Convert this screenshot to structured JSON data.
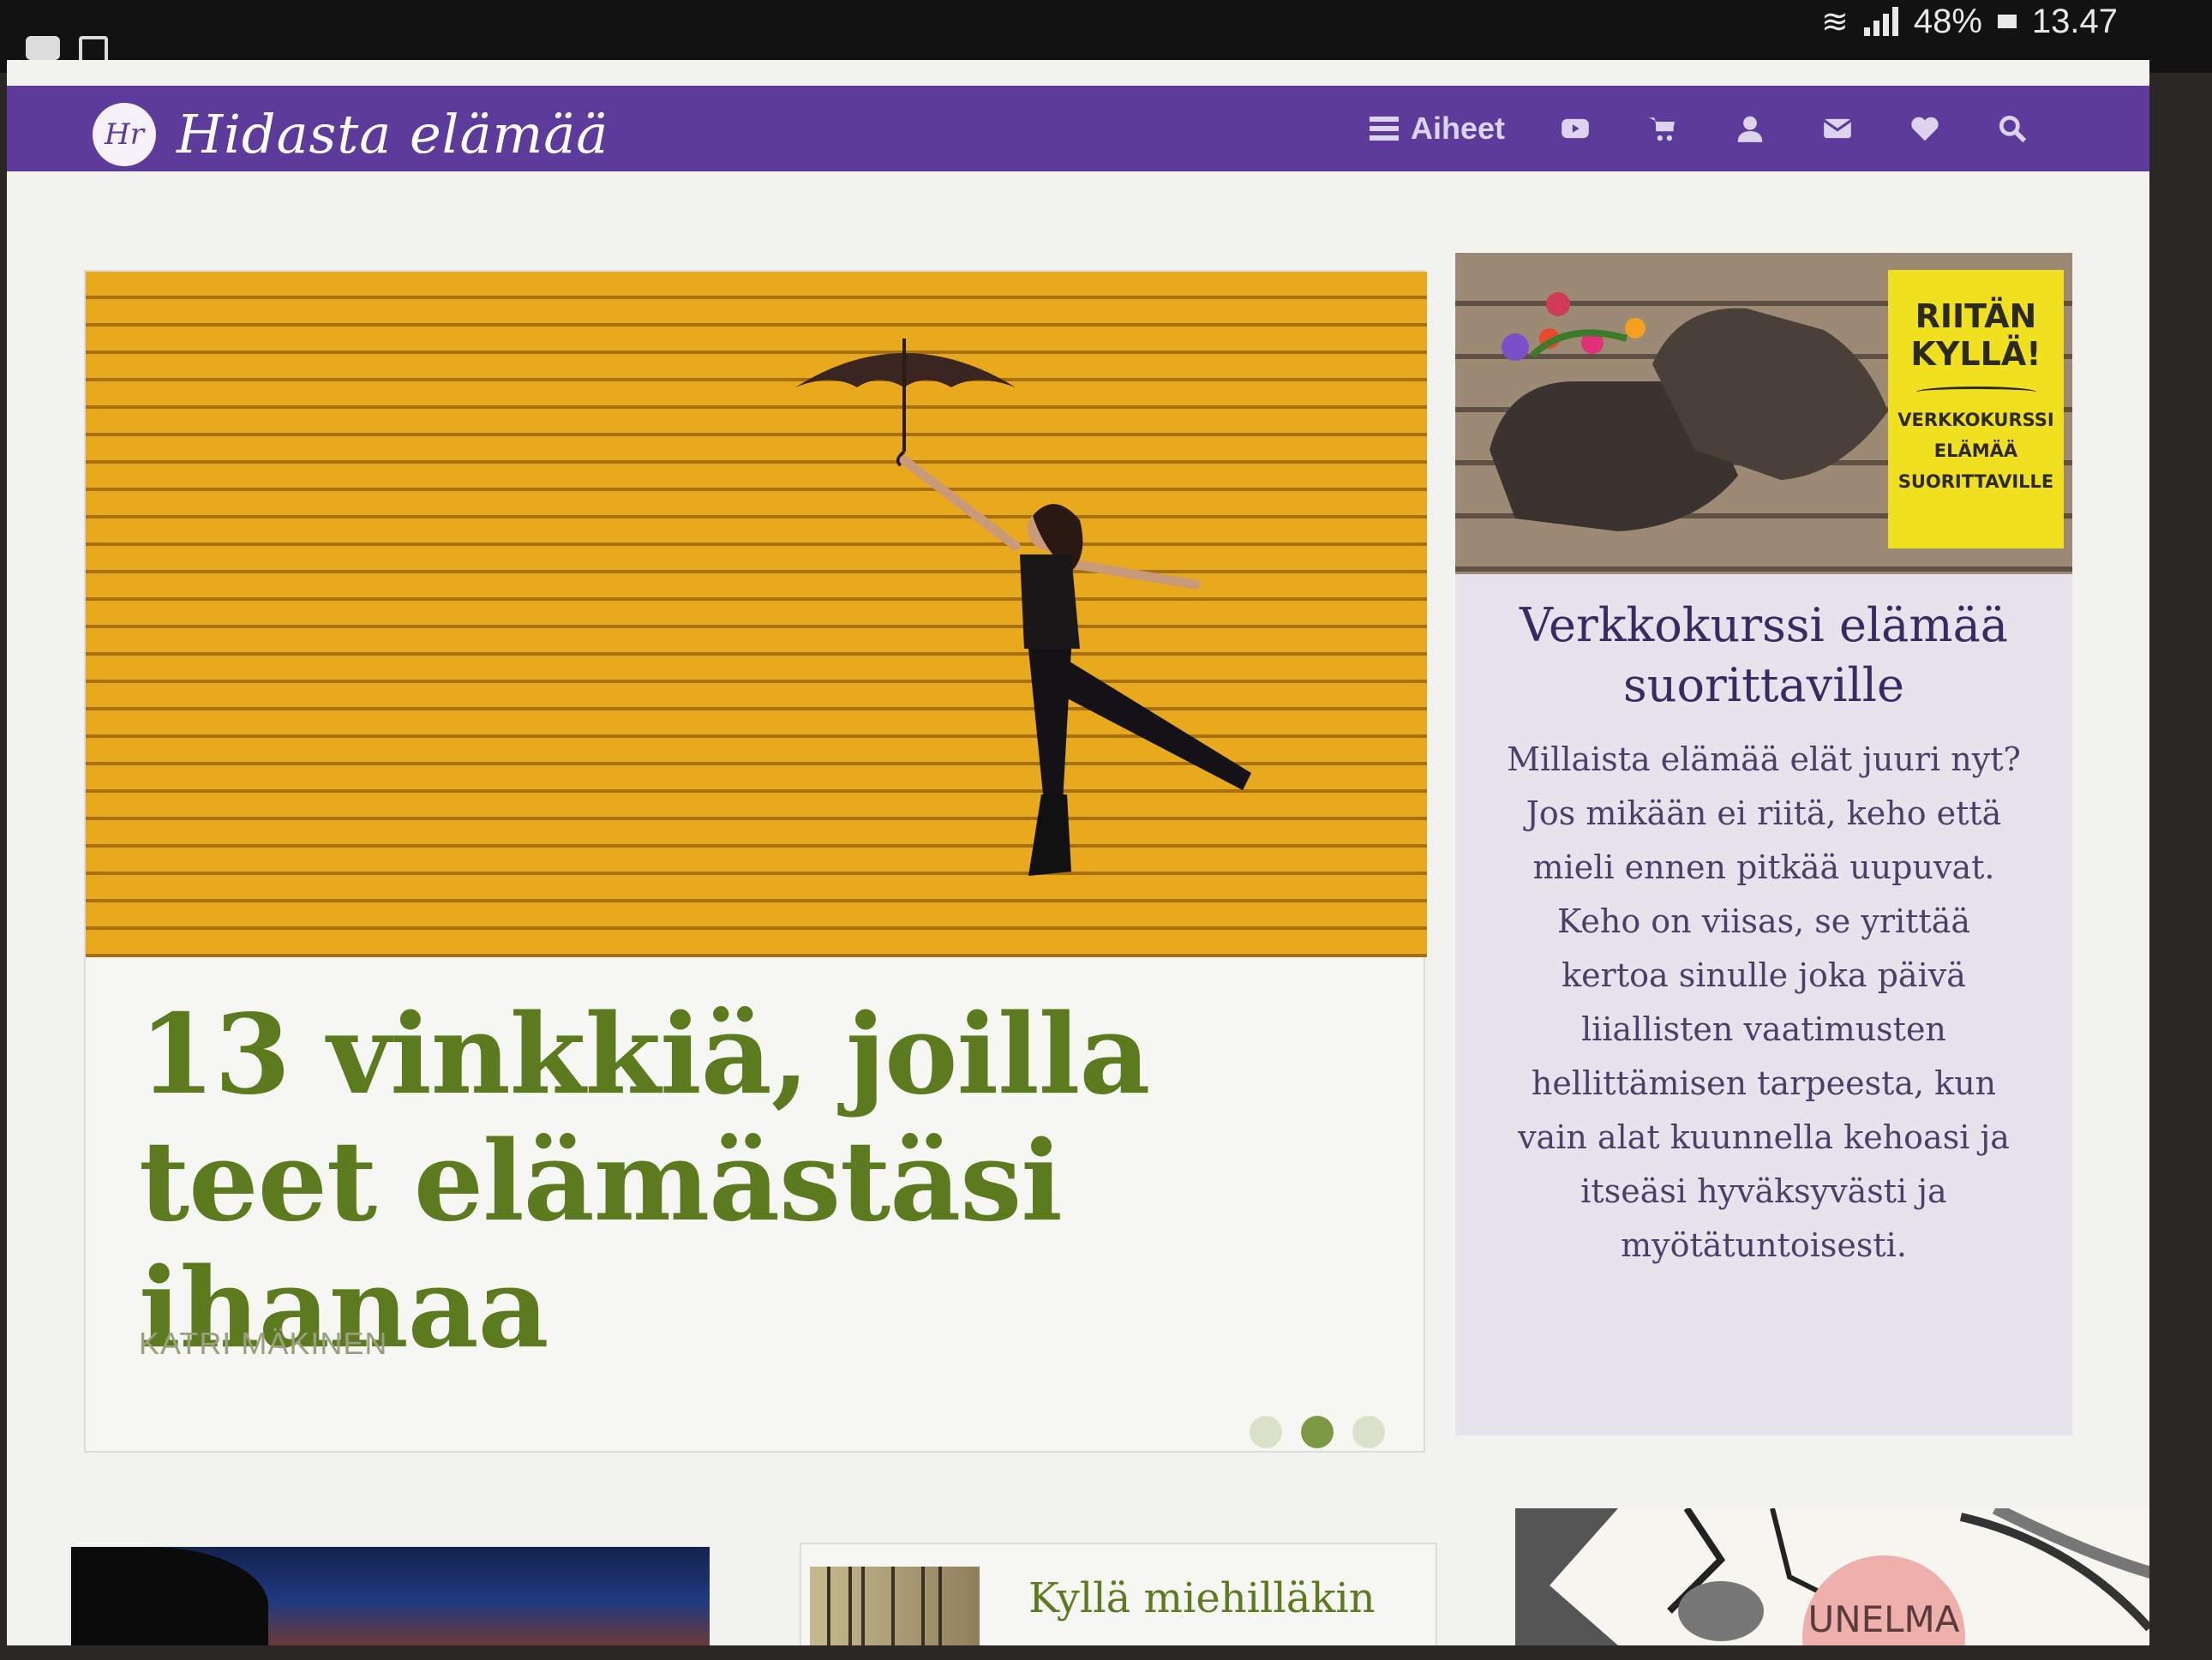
{
  "status_bar": {
    "battery": "48%",
    "time": "13.47",
    "icons": [
      "youtube-notification-icon",
      "incognito-icon",
      "wifi-icon",
      "signal-icon",
      "battery-icon"
    ]
  },
  "site": {
    "logo_mark": "Hr",
    "logo_text": "Hidasta elämää"
  },
  "nav": {
    "topics_label": "Aiheet",
    "icons": [
      "youtube-icon",
      "cart-icon",
      "user-icon",
      "mail-icon",
      "heart-icon",
      "search-icon"
    ]
  },
  "hero": {
    "title": "13 vinkkiä, joilla teet elämästäsi ihanaa",
    "author": "KATRI MÄKINEN",
    "slides_total": 3,
    "active_slide": 2
  },
  "ad": {
    "badge_line1": "RIITÄN",
    "badge_line2": "KYLLÄ!",
    "badge_small1": "VERKKOKURSSI",
    "badge_small2": "ELÄMÄÄ",
    "badge_small3": "SUORITTAVILLE",
    "title": "Verkkokurssi elämää suorittaville",
    "text": "Millaista elämää elät juuri nyt? Jos mikään ei riitä, keho että mieli ennen pitkää uupuvat. Keho on viisas, se yrittää kertoa sinulle joka päivä liiallisten vaatimusten hellittämisen tarpeesta, kun vain alat kuunnella kehoasi ja itseäsi hyväksyvästi ja myötätuntoisesti."
  },
  "bottom": {
    "post_title": "Kyllä miehilläkin",
    "sketch_badge": "UNELMA"
  },
  "colors": {
    "header": "#5d3b9a",
    "hero_title": "#5c7a1e",
    "ad_title": "#3a2a63",
    "hero_wall": "#e8a91c"
  }
}
